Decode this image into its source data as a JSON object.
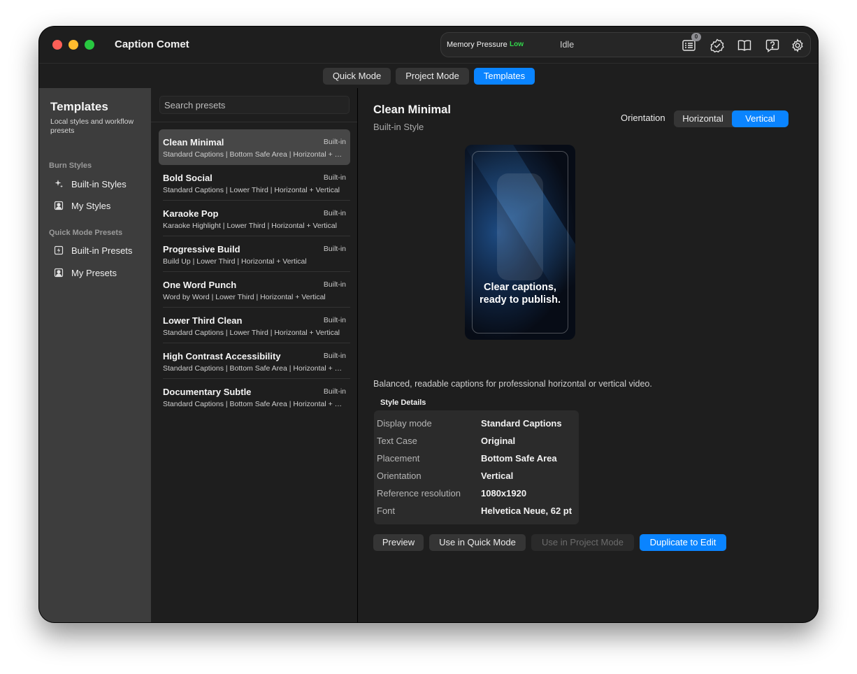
{
  "app": {
    "title": "Caption Comet"
  },
  "status": {
    "memory_label": "Memory Pressure",
    "memory_value": "Low",
    "idle": "Idle",
    "badge_count": "0",
    "icons": [
      "log-icon",
      "verified-icon",
      "book-icon",
      "help-icon",
      "gear-icon"
    ]
  },
  "modes": [
    {
      "label": "Quick Mode",
      "active": false
    },
    {
      "label": "Project Mode",
      "active": false
    },
    {
      "label": "Templates",
      "active": true
    }
  ],
  "sidebar": {
    "title": "Templates",
    "subtitle": "Local styles and workflow presets",
    "sections": [
      {
        "label": "Burn Styles",
        "items": [
          {
            "label": "Built-in Styles",
            "icon": "sparkle-icon"
          },
          {
            "label": "My Styles",
            "icon": "user-square-icon"
          }
        ]
      },
      {
        "label": "Quick Mode Presets",
        "items": [
          {
            "label": "Built-in Presets",
            "icon": "bolt-square-icon"
          },
          {
            "label": "My Presets",
            "icon": "user-square-icon"
          }
        ]
      }
    ]
  },
  "search": {
    "placeholder": "Search presets",
    "value": ""
  },
  "presets": [
    {
      "name": "Clean Minimal",
      "tag": "Built-in",
      "desc": "Standard Captions | Bottom Safe Area | Horizontal + Vertical",
      "selected": true
    },
    {
      "name": "Bold Social",
      "tag": "Built-in",
      "desc": "Standard Captions | Lower Third | Horizontal + Vertical"
    },
    {
      "name": "Karaoke Pop",
      "tag": "Built-in",
      "desc": "Karaoke Highlight | Lower Third | Horizontal + Vertical"
    },
    {
      "name": "Progressive Build",
      "tag": "Built-in",
      "desc": "Build Up | Lower Third | Horizontal + Vertical"
    },
    {
      "name": "One Word Punch",
      "tag": "Built-in",
      "desc": "Word by Word | Lower Third | Horizontal + Vertical"
    },
    {
      "name": "Lower Third Clean",
      "tag": "Built-in",
      "desc": "Standard Captions | Lower Third | Horizontal + Vertical"
    },
    {
      "name": "High Contrast Accessibility",
      "tag": "Built-in",
      "desc": "Standard Captions | Bottom Safe Area | Horizontal + Vertical"
    },
    {
      "name": "Documentary Subtle",
      "tag": "Built-in",
      "desc": "Standard Captions | Bottom Safe Area | Horizontal + Vertical"
    }
  ],
  "detail": {
    "title": "Clean Minimal",
    "subtitle": "Built-in Style",
    "orientation_label": "Orientation",
    "orientations": [
      {
        "label": "Horizontal",
        "active": false
      },
      {
        "label": "Vertical",
        "active": true
      }
    ],
    "preview_caption_line1": "Clear captions,",
    "preview_caption_line2": "ready to publish.",
    "description": "Balanced, readable captions for professional horizontal or vertical video.",
    "style_details_header": "Style Details",
    "style_details": [
      {
        "key": "Display mode",
        "value": "Standard Captions"
      },
      {
        "key": "Text Case",
        "value": "Original"
      },
      {
        "key": "Placement",
        "value": "Bottom Safe Area"
      },
      {
        "key": "Orientation",
        "value": "Vertical"
      },
      {
        "key": "Reference resolution",
        "value": "1080x1920"
      },
      {
        "key": "Font",
        "value": "Helvetica Neue, 62 pt"
      }
    ],
    "actions": [
      {
        "label": "Preview",
        "state": "normal"
      },
      {
        "label": "Use in Quick Mode",
        "state": "normal"
      },
      {
        "label": "Use in Project Mode",
        "state": "disabled"
      },
      {
        "label": "Duplicate to Edit",
        "state": "primary"
      }
    ]
  },
  "colors": {
    "accent": "#0a84ff",
    "memory_ok": "#32d74b",
    "window_bg": "#1e1e1e",
    "sidebar_bg": "#3d3d3d"
  }
}
